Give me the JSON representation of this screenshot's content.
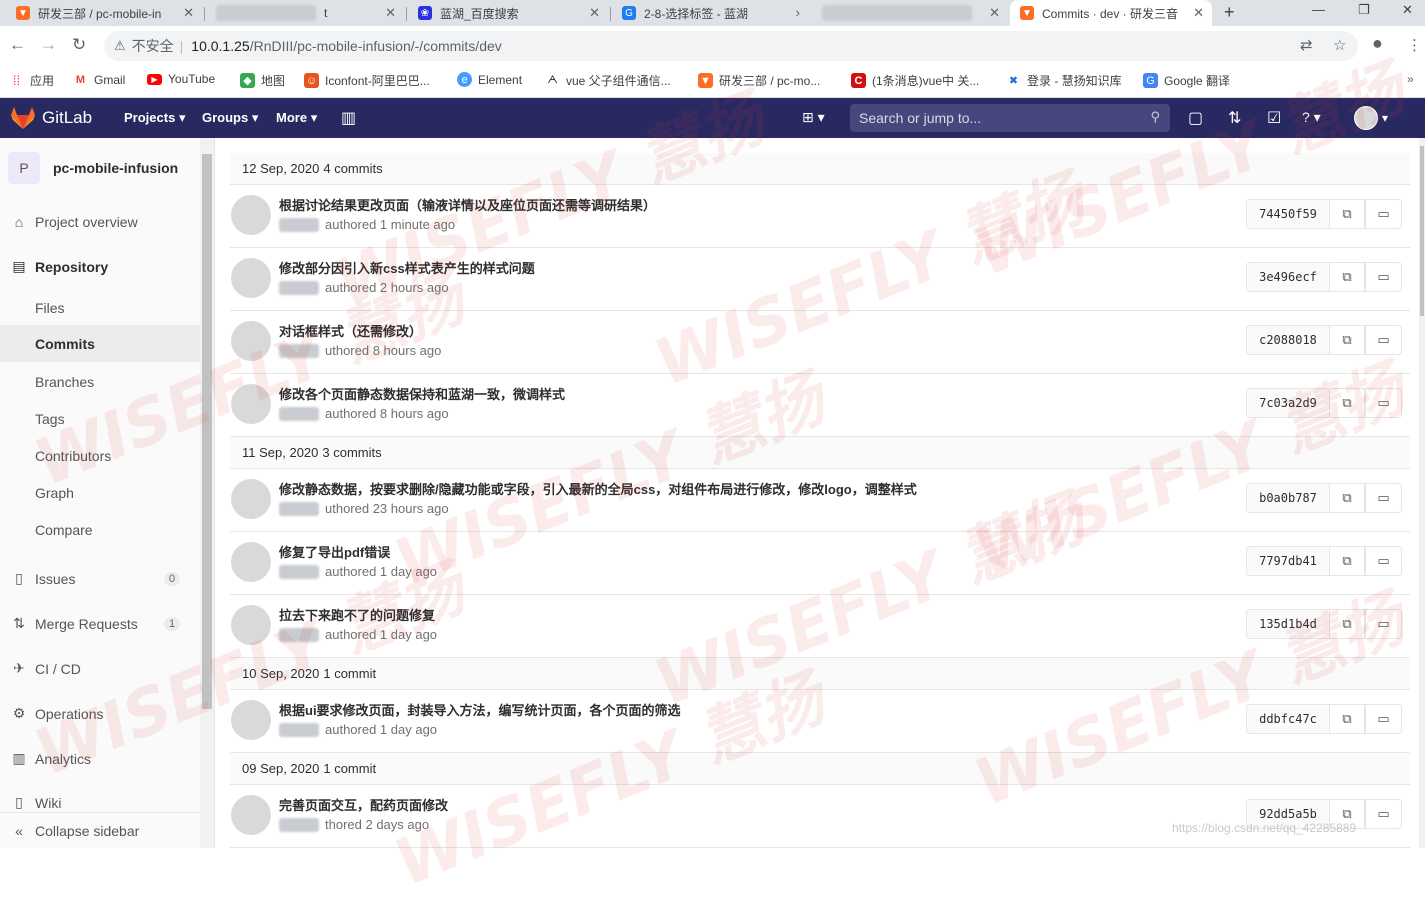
{
  "browser": {
    "tabs": [
      {
        "label": "研发三部 / pc-mobile-in",
        "icon": "gitlab-icon",
        "close": "✕"
      },
      {
        "label": "t",
        "icon": "blurred-icon",
        "close": "✕"
      },
      {
        "label": "蓝湖_百度搜索",
        "icon": "baidu-icon",
        "close": "✕"
      },
      {
        "label": "2-8-选择标签 - 蓝湖",
        "icon": "lanhu-icon",
        "close": "›"
      },
      {
        "label": "",
        "icon": "blurred-icon",
        "close": "✕"
      },
      {
        "label": "Commits · dev · 研发三音",
        "icon": "gitlab-icon",
        "close": "✕"
      }
    ],
    "new_tab": "+",
    "window_controls": {
      "minimize": "—",
      "restore": "❐",
      "close": "✕"
    },
    "nav": {
      "back": "←",
      "forward": "→",
      "reload": "↻"
    },
    "address": {
      "warning": "⚠",
      "insecure": "不安全",
      "pipe": "|",
      "host": "10.0.1.25",
      "path": "/RnDIII/pc-mobile-infusion/-/commits/dev"
    },
    "omni_icons": {
      "translate": "⇄",
      "star": "☆",
      "profile": "●",
      "menu": "⋮"
    },
    "bookmarks": [
      {
        "label": "应用",
        "icon": "apps-icon"
      },
      {
        "label": "Gmail",
        "icon": "gmail-icon"
      },
      {
        "label": "YouTube",
        "icon": "youtube-icon"
      },
      {
        "label": "地图",
        "icon": "maps-icon"
      },
      {
        "label": "Iconfont-阿里巴巴...",
        "icon": "iconfont-icon"
      },
      {
        "label": "Element",
        "icon": "element-icon"
      },
      {
        "label": "vue 父子组件通信...",
        "icon": "vue-icon"
      },
      {
        "label": "研发三部 / pc-mo...",
        "icon": "gitlab-icon"
      },
      {
        "label": "(1条消息)vue中 关...",
        "icon": "csdn-icon"
      },
      {
        "label": "登录 - 慧扬知识库",
        "icon": "wisefly-icon"
      },
      {
        "label": "Google 翻译",
        "icon": "google-translate-icon"
      }
    ],
    "bookmarks_more": "»"
  },
  "gitlab": {
    "brand": "GitLab",
    "menu": [
      {
        "label": "Projects",
        "caret": "▾"
      },
      {
        "label": "Groups",
        "caret": "▾"
      },
      {
        "label": "More",
        "caret": "▾"
      }
    ],
    "search_placeholder": "Search or jump to...",
    "header_icons": {
      "chart": "▥",
      "plus": "⊞ ▾",
      "search": "⚲",
      "issues": "▢",
      "mr": "⇅",
      "todo": "☑",
      "help": "? ▾",
      "user_caret": "▾"
    }
  },
  "sidebar": {
    "project_initial": "P",
    "project_name": "pc-mobile-infusion",
    "items": [
      {
        "label": "Project overview",
        "icon": "⌂"
      },
      {
        "label": "Repository",
        "icon": "▤"
      },
      {
        "label": "Files"
      },
      {
        "label": "Commits"
      },
      {
        "label": "Branches"
      },
      {
        "label": "Tags"
      },
      {
        "label": "Contributors"
      },
      {
        "label": "Graph"
      },
      {
        "label": "Compare"
      },
      {
        "label": "Issues",
        "icon": "▯",
        "badge": "0"
      },
      {
        "label": "Merge Requests",
        "icon": "⇅",
        "badge": "1"
      },
      {
        "label": "CI / CD",
        "icon": "✈"
      },
      {
        "label": "Operations",
        "icon": "⚙"
      },
      {
        "label": "Analytics",
        "icon": "▥"
      },
      {
        "label": "Wiki",
        "icon": "▯"
      }
    ],
    "collapse_label": "Collapse sidebar",
    "collapse_icon": "«"
  },
  "commit_groups": [
    {
      "date": "12 Sep, 2020",
      "count": "4 commits",
      "commits": [
        {
          "title": "根据讨论结果更改页面（输液详情以及座位页面还需等调研结果）",
          "meta": "authored 1 minute ago",
          "sha": "74450f59"
        },
        {
          "title": "修改部分因引入新css样式表产生的样式问题",
          "meta": "authored 2 hours ago",
          "sha": "3e496ecf"
        },
        {
          "title": "对话框样式（还需修改）",
          "meta": "uthored 8 hours ago",
          "sha": "c2088018"
        },
        {
          "title": "修改各个页面静态数据保持和蓝湖一致，微调样式",
          "meta": "authored 8 hours ago",
          "sha": "7c03a2d9"
        }
      ]
    },
    {
      "date": "11 Sep, 2020",
      "count": "3 commits",
      "commits": [
        {
          "title": "修改静态数据，按要求删除/隐藏功能或字段，引入最新的全局css，对组件布局进行修改，修改logo，调整样式",
          "meta": "uthored 23 hours ago",
          "sha": "b0a0b787"
        },
        {
          "title": "修复了导出pdf错误",
          "meta": "authored 1 day ago",
          "sha": "7797db41"
        },
        {
          "title": "拉去下来跑不了的问题修复",
          "meta": "authored 1 day ago",
          "sha": "135d1b4d"
        }
      ]
    },
    {
      "date": "10 Sep, 2020",
      "count": "1 commit",
      "commits": [
        {
          "title": "根据ui要求修改页面，封装导入方法，编写统计页面，各个页面的筛选",
          "meta": "authored 1 day ago",
          "sha": "ddbfc47c"
        }
      ]
    },
    {
      "date": "09 Sep, 2020",
      "count": "1 commit",
      "commits": [
        {
          "title": "完善页面交互，配药页面修改",
          "meta": "thored 2 days ago",
          "sha": "92dd5a5b"
        }
      ]
    }
  ],
  "commit_actions": {
    "copy_icon": "⧉",
    "browse_icon": "▭"
  },
  "watermark": {
    "text": "WISEFLY 慧扬"
  },
  "credit": "https://blog.csdn.net/qq_42285889"
}
